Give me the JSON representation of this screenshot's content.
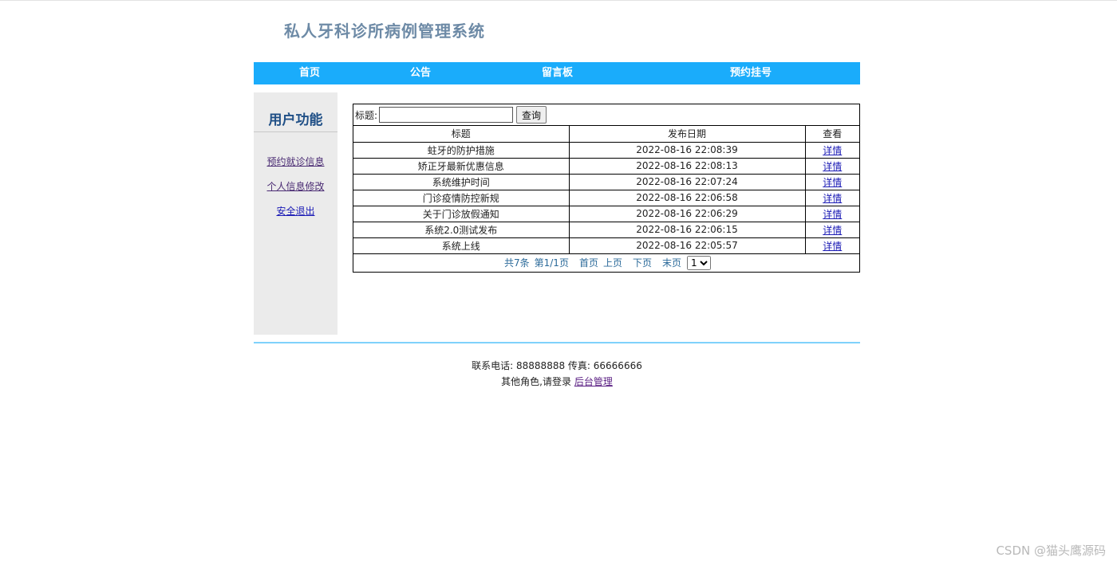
{
  "header": {
    "title": "私人牙科诊所病例管理系统"
  },
  "nav": {
    "home": "首页",
    "notice": "公告",
    "guestbook": "留言板",
    "appointment": "预约挂号"
  },
  "sidebar": {
    "title": "用户功能",
    "items": [
      {
        "label": "预约就诊信息"
      },
      {
        "label": "个人信息修改"
      },
      {
        "label": "安全退出"
      }
    ]
  },
  "search": {
    "label": "标题:",
    "value": "",
    "button": "查询"
  },
  "table": {
    "headers": [
      "标题",
      "发布日期",
      "查看"
    ],
    "rows": [
      {
        "title": "蛀牙的防护措施",
        "date": "2022-08-16 22:08:39",
        "action": "详情"
      },
      {
        "title": "矫正牙最新优惠信息",
        "date": "2022-08-16 22:08:13",
        "action": "详情"
      },
      {
        "title": "系统维护时间",
        "date": "2022-08-16 22:07:24",
        "action": "详情"
      },
      {
        "title": "门诊疫情防控新规",
        "date": "2022-08-16 22:06:58",
        "action": "详情"
      },
      {
        "title": "关于门诊放假通知",
        "date": "2022-08-16 22:06:29",
        "action": "详情"
      },
      {
        "title": "系统2.0测试发布",
        "date": "2022-08-16 22:06:15",
        "action": "详情"
      },
      {
        "title": "系统上线",
        "date": "2022-08-16 22:05:57",
        "action": "详情"
      }
    ]
  },
  "pager": {
    "total": "共7条",
    "page_info": "第1/1页",
    "first": "首页",
    "prev": "上页",
    "next": "下页",
    "last": "末页",
    "selected": "1"
  },
  "footer": {
    "contact": "联系电话: 88888888 传真: 66666666",
    "login_prompt": "其他角色,请登录",
    "admin_link": "后台管理"
  },
  "watermark": "CSDN @猫头鹰源码",
  "colors": {
    "nav_bg": "#1aacfb",
    "sidebar_bg": "#ebebeb",
    "title": "#6d8aa6",
    "divider": "#7fd2fb"
  }
}
